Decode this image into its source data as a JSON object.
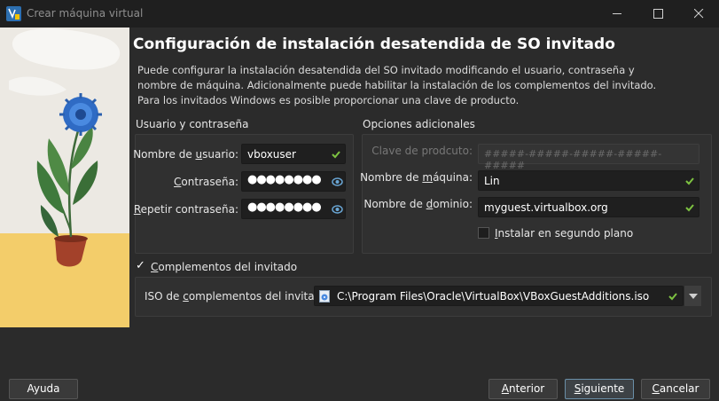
{
  "window": {
    "title": "Crear máquina virtual"
  },
  "page": {
    "heading": "Configuración de instalación desatendida de SO invitado",
    "description": "Puede configurar la instalación desatendida del SO invitado modificando el usuario, contraseña y nombre de máquina. Adicionalmente puede habilitar la instalación de los complementos del invitado. Para los invitados Windows es posible proporcionar una clave de producto."
  },
  "user_group": {
    "title": "Usuario y contraseña",
    "username_label": "Nombre de usuario:",
    "username_value": "vboxuser",
    "password_label": "Contraseña:",
    "password_value": "●●●●●●●●",
    "repeat_label": "Repetir contraseña:",
    "repeat_value": "●●●●●●●●"
  },
  "extra_group": {
    "title": "Opciones adicionales",
    "product_key_label": "Clave de prodcuto:",
    "product_key_placeholder": "#####-#####-#####-#####-#####",
    "hostname_label": "Nombre de máquina:",
    "hostname_value": "Lin",
    "domain_label": "Nombre de dominio:",
    "domain_value": "myguest.virtualbox.org",
    "background_label": "Instalar en segundo plano",
    "background_checked": false
  },
  "additions": {
    "label": "Complementos del invitado",
    "checked": true,
    "iso_label": "ISO de complementos del invitado:",
    "iso_path": "C:\\Program Files\\Oracle\\VirtualBox\\VBoxGuestAdditions.iso"
  },
  "buttons": {
    "help": "Ayuda",
    "back": "Anterior",
    "next": "Siguiente",
    "cancel": "Cancelar"
  },
  "colors": {
    "valid_check": "#7dc241",
    "eye_icon": "#6aa7d6"
  }
}
